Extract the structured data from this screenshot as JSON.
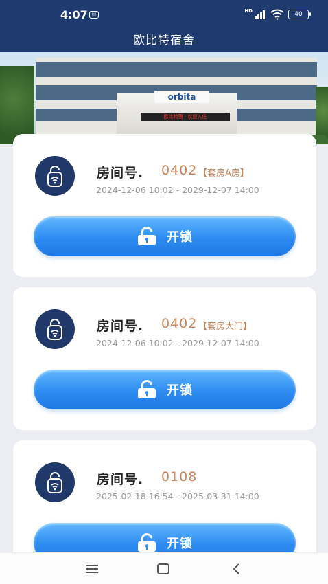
{
  "status_bar": {
    "time": "4:07",
    "network_label": "HD",
    "battery": "40"
  },
  "header": {
    "title": "欧比特宿舍"
  },
  "banner": {
    "logo_text": "orbita",
    "sign_text": "欧比特宿 · 欢迎入住"
  },
  "rooms": [
    {
      "label": "房间号.",
      "number": "0402",
      "type": "【套房A房】",
      "period": "2024-12-06 10:02 - 2029-12-07 14:00",
      "unlock_label": "开锁"
    },
    {
      "label": "房间号.",
      "number": "0402",
      "type": "【套房大门】",
      "period": "2024-12-06 10:02 - 2029-12-07 14:00",
      "unlock_label": "开锁"
    },
    {
      "label": "房间号.",
      "number": "0108",
      "type": "",
      "period": "2025-02-18 16:54 - 2025-03-31 14:00",
      "unlock_label": "开锁"
    }
  ],
  "icons": {
    "room_badge": "door-lock-wifi-icon",
    "unlock": "unlocked-padlock-icon",
    "nav_menu": "menu-icon",
    "nav_home": "home-square-icon",
    "nav_back": "back-chevron-icon"
  },
  "colors": {
    "header_bg": "#1f3a6e",
    "accent_orange": "#c8855a",
    "button_blue": "#2d8cf0"
  }
}
